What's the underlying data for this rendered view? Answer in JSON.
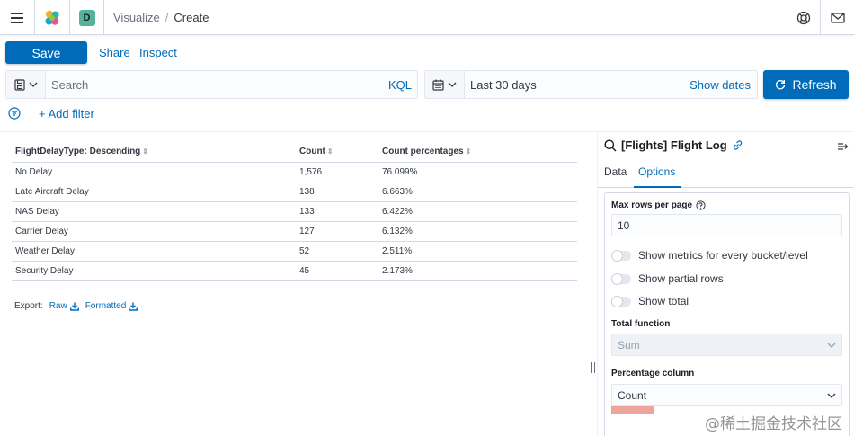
{
  "header": {
    "space_initial": "D",
    "breadcrumbs": [
      "Visualize",
      "Create"
    ],
    "breadcrumb_separator": "/"
  },
  "top_nav": {
    "save_label": "Save",
    "share_label": "Share",
    "inspect_label": "Inspect"
  },
  "query_bar": {
    "search_placeholder": "Search",
    "language": "KQL",
    "date_range": "Last 30 days",
    "show_dates_label": "Show dates",
    "refresh_label": "Refresh"
  },
  "filter_bar": {
    "add_filter_label": "+ Add filter"
  },
  "table": {
    "columns": [
      "FlightDelayType: Descending",
      "Count",
      "Count percentages"
    ],
    "rows": [
      [
        "No Delay",
        "1,576",
        "76.099%"
      ],
      [
        "Late Aircraft Delay",
        "138",
        "6.663%"
      ],
      [
        "NAS Delay",
        "133",
        "6.422%"
      ],
      [
        "Carrier Delay",
        "127",
        "6.132%"
      ],
      [
        "Weather Delay",
        "52",
        "2.511%"
      ],
      [
        "Security Delay",
        "45",
        "2.173%"
      ]
    ],
    "sort_glyph": "⇕"
  },
  "export": {
    "label": "Export:",
    "raw_label": "Raw",
    "formatted_label": "Formatted"
  },
  "sidebar": {
    "title": "[Flights] Flight Log",
    "tabs": [
      "Data",
      "Options"
    ],
    "active_tab": "Options",
    "max_rows_label": "Max rows per page",
    "max_rows_value": "10",
    "toggles": [
      "Show metrics for every bucket/level",
      "Show partial rows",
      "Show total"
    ],
    "total_function_label": "Total function",
    "total_function_value": "Sum",
    "percentage_column_label": "Percentage column",
    "percentage_column_value": "Count"
  },
  "watermark": "@稀土掘金技术社区",
  "colors": {
    "primary": "#006bb8",
    "text": "#343741",
    "border": "#d3dae6",
    "space_badge": "#54b399"
  }
}
